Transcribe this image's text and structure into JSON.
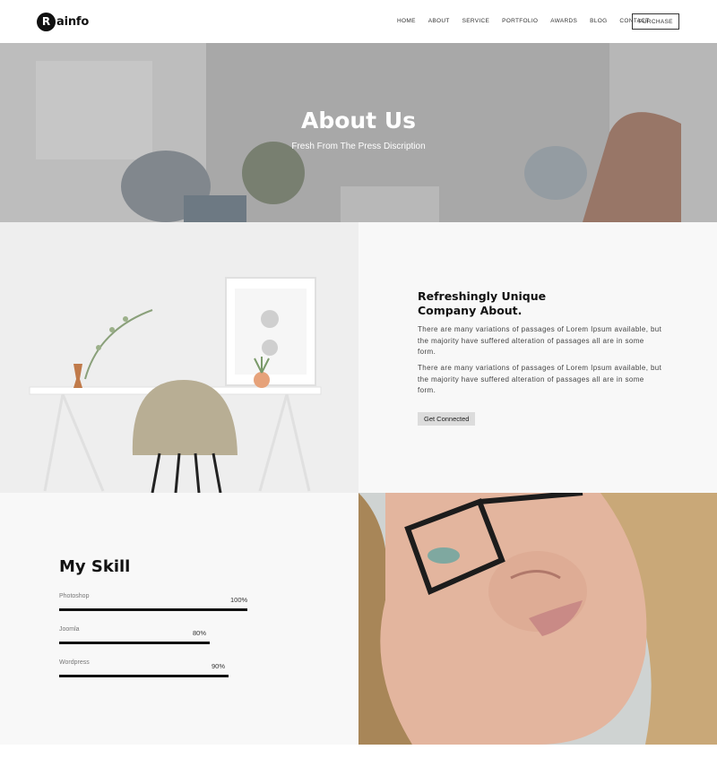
{
  "header": {
    "logo_mark": "R",
    "logo_text": "ainfo",
    "nav": [
      "HOME",
      "ABOUT",
      "SERVICE",
      "PORTFOLIO",
      "AWARDS",
      "BLOG",
      "CONTACT"
    ],
    "purchase_label": "PURCHASE"
  },
  "hero": {
    "title": "About Us",
    "subtitle": "Fresh From The Press Discription"
  },
  "about": {
    "heading_line1": "Refreshingly Unique",
    "heading_line2": "Company About.",
    "paragraph1": "There are many variations of passages of Lorem Ipsum available, but the majority have suffered alteration of passages all are in some form.",
    "paragraph2": "There are many variations of passages of Lorem Ipsum available, but the majority have suffered alteration of passages all are in some form.",
    "cta_label": "Get Connected"
  },
  "skills": {
    "title": "My Skill",
    "items": [
      {
        "name": "Photoshop",
        "percent_label": "100%",
        "level": 1.0
      },
      {
        "name": "Joomla",
        "percent_label": "80%",
        "level": 0.8
      },
      {
        "name": "Wordpress",
        "percent_label": "90%",
        "level": 0.9
      }
    ]
  },
  "colors": {
    "accent": "#111111",
    "section_bg": "#f8f8f8",
    "button_bg": "#dcdcdc"
  }
}
